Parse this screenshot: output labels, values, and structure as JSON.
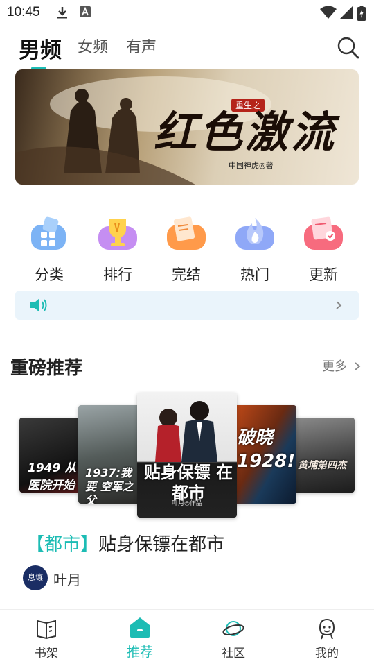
{
  "status_bar": {
    "time": "10:45",
    "icons": [
      "download-icon",
      "app-a-icon",
      "wifi-icon",
      "signal-icon",
      "battery-icon"
    ]
  },
  "top_tabs": {
    "tabs": [
      {
        "label": "男频",
        "active": true
      },
      {
        "label": "女频",
        "active": false
      },
      {
        "label": "有声",
        "active": false
      }
    ],
    "search_icon": "search-icon",
    "accent_color": "#1cbcb4"
  },
  "banner": {
    "tag": "重生之",
    "title": "红色激流",
    "author": "中国神虎◎著"
  },
  "quick_links": [
    {
      "label": "分类",
      "icon": "category-icon"
    },
    {
      "label": "排行",
      "icon": "trophy-icon"
    },
    {
      "label": "完结",
      "icon": "finished-icon"
    },
    {
      "label": "热门",
      "icon": "flame-icon"
    },
    {
      "label": "更新",
      "icon": "update-icon"
    }
  ],
  "audio_bar": {
    "icon": "speaker-icon",
    "arrow_icon": "chevron-right-icon"
  },
  "featured_section": {
    "title": "重磅推荐",
    "more_label": "更多",
    "covers": [
      {
        "title": "1949 从医院开始",
        "theme": "dark-red"
      },
      {
        "title": "1937:我要 空军之父",
        "theme": "war-gray"
      },
      {
        "title": "贴身保镖 在都市",
        "theme": "urban-light",
        "author_credit": "叶月◎作品"
      },
      {
        "title": "破晓 1928!",
        "theme": "fire-blue"
      },
      {
        "title": "黄埔第四杰",
        "theme": "gray-city"
      }
    ],
    "selected_book": {
      "genre": "【都市】",
      "title": "贴身保镖在都市",
      "author_name": "叶月",
      "author_avatar_text": "息壤"
    }
  },
  "bottom_nav": {
    "items": [
      {
        "label": "书架",
        "icon": "bookshelf-icon",
        "active": false
      },
      {
        "label": "推荐",
        "icon": "recommend-icon",
        "active": true
      },
      {
        "label": "社区",
        "icon": "planet-icon",
        "active": false
      },
      {
        "label": "我的",
        "icon": "profile-icon",
        "active": false
      }
    ]
  }
}
